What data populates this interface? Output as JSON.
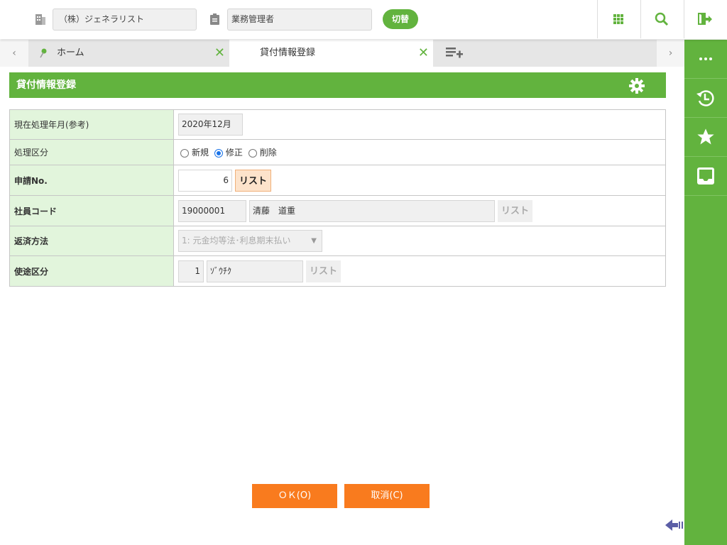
{
  "topbar": {
    "company": "（株）ジェネラリスト",
    "role": "業務管理者",
    "switch_label": "切替"
  },
  "tabs": [
    {
      "label": "ホーム"
    },
    {
      "label": "貸付情報登録"
    }
  ],
  "page_title": "貸付情報登録",
  "form": {
    "rows": [
      {
        "label": "現在処理年月(参考)",
        "value": "2020年12月"
      },
      {
        "label": "処理区分",
        "options": [
          "新規",
          "修正",
          "削除"
        ],
        "selected": "修正"
      },
      {
        "label": "申請No.",
        "value": "6",
        "button": "リスト"
      },
      {
        "label": "社員コード",
        "code": "19000001",
        "name": "清藤　道重",
        "button": "リスト"
      },
      {
        "label": "返済方法",
        "value": "1: 元金均等法･利息期末払い"
      },
      {
        "label": "使途区分",
        "code": "1",
        "name": "ｿﾞｳﾁｸ",
        "button": "リスト"
      }
    ]
  },
  "buttons": {
    "ok": "ＯＫ(O)",
    "cancel": "取消(C)"
  },
  "colors": {
    "accent": "#62b33e",
    "orange": "#f97b1e",
    "label_bg": "#e2f5dc"
  }
}
